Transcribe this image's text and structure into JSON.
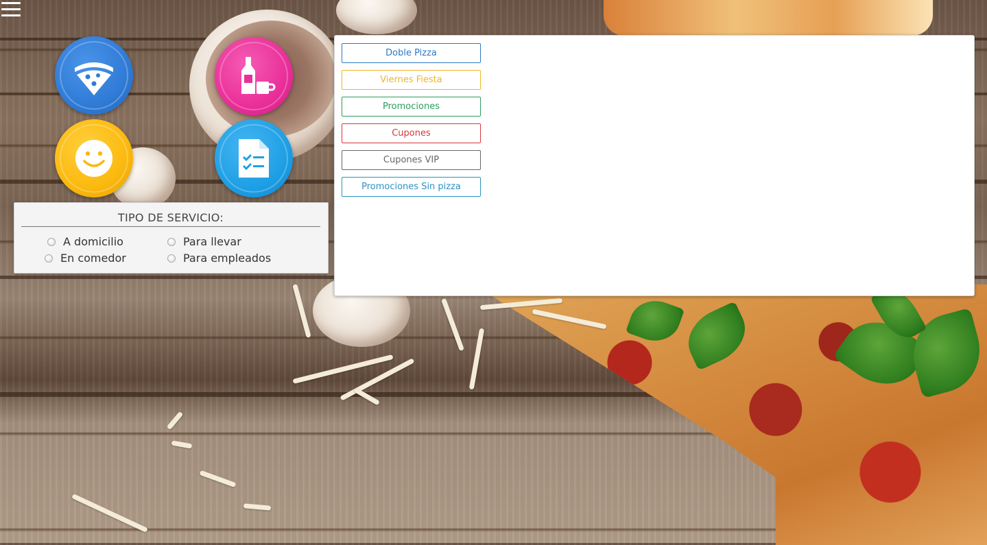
{
  "menu": {
    "icon": "hamburger-menu-icon"
  },
  "nav_buttons": [
    {
      "name": "pizza",
      "icon": "pizza-slice-icon",
      "color": "#2f7bd6"
    },
    {
      "name": "drinks",
      "icon": "bottle-cup-icon",
      "color": "#ea2f9a"
    },
    {
      "name": "customer",
      "icon": "smiley-face-icon",
      "color": "#fbb90e"
    },
    {
      "name": "order",
      "icon": "checklist-document-icon",
      "color": "#1e9fe5"
    }
  ],
  "service": {
    "title": "TIPO DE SERVICIO:",
    "options": [
      "A domicilio",
      "Para llevar",
      "En comedor",
      "Para empleados"
    ]
  },
  "promos": [
    {
      "label": "Doble Pizza",
      "color": "#2b79c2"
    },
    {
      "label": "Viernes Fiesta",
      "color": "#f0b624"
    },
    {
      "label": "Promociones",
      "color": "#2a9d5a"
    },
    {
      "label": "Cupones",
      "color": "#d9363e"
    },
    {
      "label": "Cupones VIP",
      "color": "#666666"
    },
    {
      "label": "Promociones Sin pizza",
      "color": "#2a93c0"
    }
  ]
}
